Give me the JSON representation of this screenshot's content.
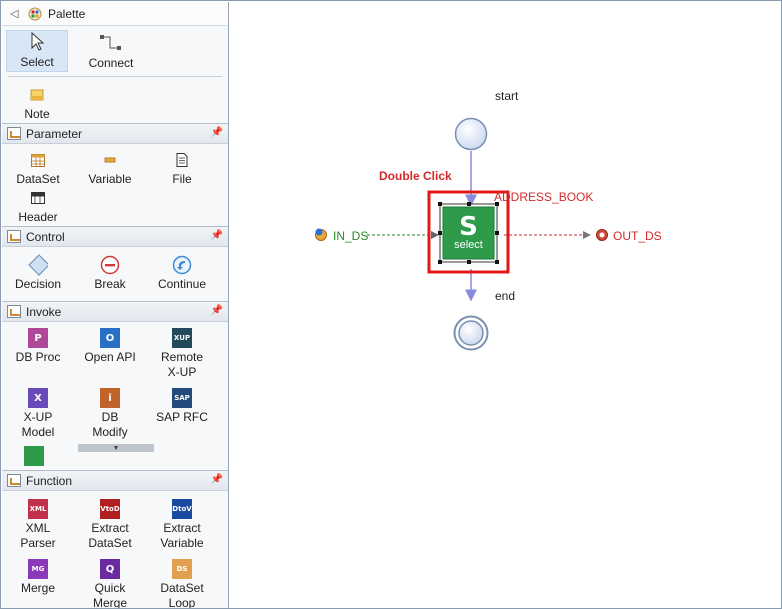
{
  "palette": {
    "title": "Palette",
    "tools": [
      {
        "label": "Select",
        "icon": "cursor-arrow-icon",
        "selected": true
      },
      {
        "label": "Connect",
        "icon": "connector-icon",
        "selected": false
      }
    ],
    "note": {
      "label": "Note",
      "icon": "note-icon"
    },
    "sections": [
      {
        "title": "Parameter",
        "items": [
          {
            "label": "DataSet",
            "icon": "dataset-icon"
          },
          {
            "label": "Variable",
            "icon": "variable-icon"
          },
          {
            "label": "File",
            "icon": "file-icon"
          },
          {
            "label": "Header",
            "icon": "header-icon"
          }
        ]
      },
      {
        "title": "Control",
        "items": [
          {
            "label": "Decision",
            "icon": "decision-icon"
          },
          {
            "label": "Break",
            "icon": "break-icon"
          },
          {
            "label": "Continue",
            "icon": "continue-icon"
          }
        ]
      },
      {
        "title": "Invoke",
        "items": [
          {
            "label": "DB Proc",
            "icon": "db-proc-icon",
            "tile": "P"
          },
          {
            "label": "Open API",
            "icon": "open-api-icon",
            "tile": "O"
          },
          {
            "label": "Remote X-UP",
            "line1": "Remote",
            "line2": "X-UP",
            "icon": "remote-xup-icon",
            "tile": "XUP"
          },
          {
            "label": "X-UP Model",
            "line1": "X-UP",
            "line2": "Model",
            "icon": "xup-model-icon",
            "tile": "X"
          },
          {
            "label": "DB Modify",
            "line1": "DB",
            "line2": "Modify",
            "icon": "db-modify-icon",
            "tile": "i"
          },
          {
            "label": "SAP RFC",
            "icon": "sap-rfc-icon",
            "tile": "SAP"
          }
        ]
      },
      {
        "title": "Function",
        "items": [
          {
            "label": "XML Parser",
            "line1": "XML",
            "line2": "Parser",
            "icon": "xml-parser-icon",
            "tile": "XML"
          },
          {
            "label": "Extract DataSet",
            "line1": "Extract",
            "line2": "DataSet",
            "icon": "extract-dataset-icon",
            "tile": "VtoD"
          },
          {
            "label": "Extract Variable",
            "line1": "Extract",
            "line2": "Variable",
            "icon": "extract-variable-icon",
            "tile": "DtoV"
          },
          {
            "label": "Merge",
            "icon": "merge-icon",
            "tile": "MG"
          },
          {
            "label": "Quick Merge",
            "line1": "Quick",
            "line2": "Merge",
            "icon": "quick-merge-icon",
            "tile": "Q"
          },
          {
            "label": "DataSet Loop",
            "line1": "DataSet",
            "line2": "Loop",
            "icon": "dataset-loop-icon",
            "tile": "DS"
          }
        ]
      }
    ]
  },
  "canvas": {
    "start_label": "start",
    "end_label": "end",
    "hint_label": "Double Click",
    "node_title": "ADDRESS_BOOK",
    "node_letter": "S",
    "node_caption": "select",
    "input_label": "IN_DS",
    "output_label": "OUT_DS",
    "colors": {
      "node": "#2e9a4a",
      "highlight": "#e01818",
      "input_line": "#2a8a2a",
      "output_line": "#c43232",
      "flow": "#8a8ae0",
      "event": "#dce6f4"
    }
  }
}
